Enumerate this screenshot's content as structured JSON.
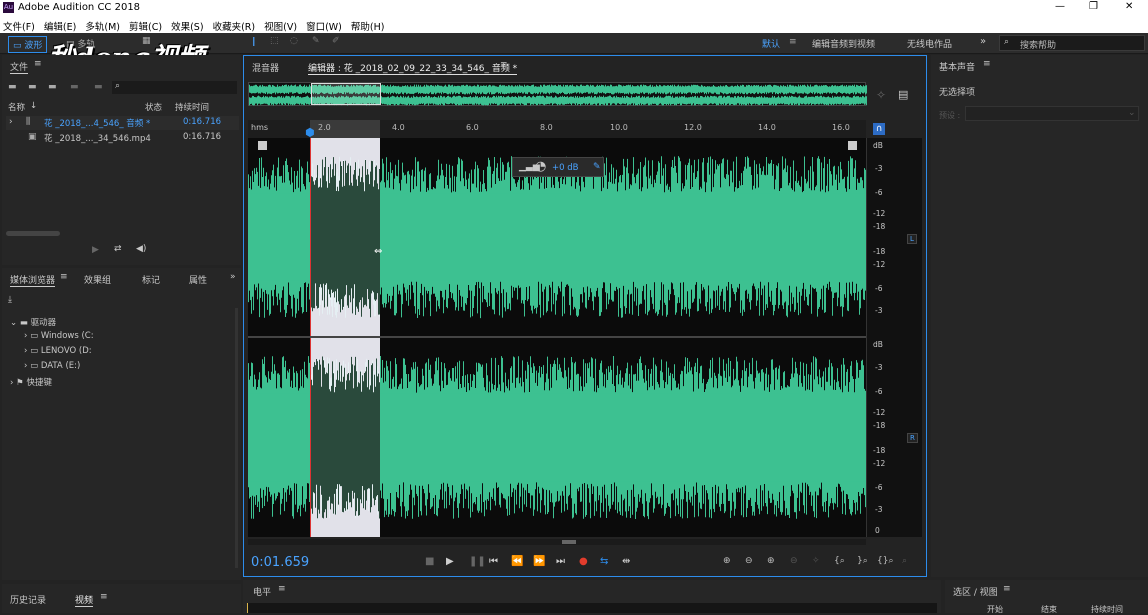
{
  "app": {
    "title": "Adobe Audition CC 2018",
    "window_controls": [
      "—",
      "❐",
      "✕"
    ]
  },
  "menu": [
    "文件(F)",
    "编辑(E)",
    "多轨(M)",
    "剪辑(C)",
    "效果(S)",
    "收藏夹(R)",
    "视图(V)",
    "窗口(W)",
    "帮助(H)"
  ],
  "toolbar": {
    "waveform_label": "波形",
    "multitrack_label": "多轨",
    "workspace_default": "默认",
    "workspace_edit_video": "编辑音频到视频",
    "workspace_radio": "无线电作品",
    "search_placeholder": "搜索帮助"
  },
  "watermark": "秒dong视频",
  "files_panel": {
    "tab": "文件",
    "columns": {
      "name": "名称",
      "status": "状态",
      "duration": "持续时间"
    },
    "items": [
      {
        "name": "花 _2018_...4_546_ 音频 *",
        "duration": "0:16.716"
      },
      {
        "name": "花 _2018_..._34_546.mp4",
        "duration": "0:16.716"
      }
    ]
  },
  "media_panel": {
    "tabs": [
      "媒体浏览器",
      "效果组",
      "标记",
      "属性"
    ],
    "tree": {
      "root": "驱动器",
      "drives": [
        "Windows (C:",
        "LENOVO (D:",
        "DATA (E:)"
      ],
      "shortcuts": "快捷键"
    }
  },
  "history_panel": {
    "tabs": [
      "历史记录",
      "视频"
    ]
  },
  "editor": {
    "tab_mixer": "混音器",
    "tab_editor": "编辑器 : 花 _2018_02_09_22_33_34_546_ 音频 *",
    "timecode": "0:01.659",
    "ruler_unit": "hms",
    "ruler_ticks": [
      "2.0",
      "4.0",
      "6.0",
      "8.0",
      "10.0",
      "12.0",
      "14.0",
      "16.0"
    ],
    "hud_gain": "+0 dB",
    "channel_left": "L",
    "channel_right": "R",
    "db_scale": [
      "dB",
      "-3",
      "-6",
      "-12",
      "-18",
      "-18",
      "-12",
      "-6",
      "-3"
    ],
    "db_scale_r": [
      "dB",
      "-3",
      "-6",
      "-12",
      "-18",
      "-18",
      "-12",
      "-6",
      "-3",
      "0"
    ]
  },
  "right_panel": {
    "title": "基本声音",
    "status": "无选择项",
    "preset_label": "预设 :"
  },
  "levels_panel": {
    "title": "电平"
  },
  "selection_panel": {
    "title": "选区 / 视图",
    "cols": [
      "开始",
      "结束",
      "持续时间"
    ]
  },
  "colors": {
    "waveform": "#3dc191",
    "selection": "#f2f2fb",
    "accent": "#2d8ceb",
    "record": "#e23c2c"
  }
}
